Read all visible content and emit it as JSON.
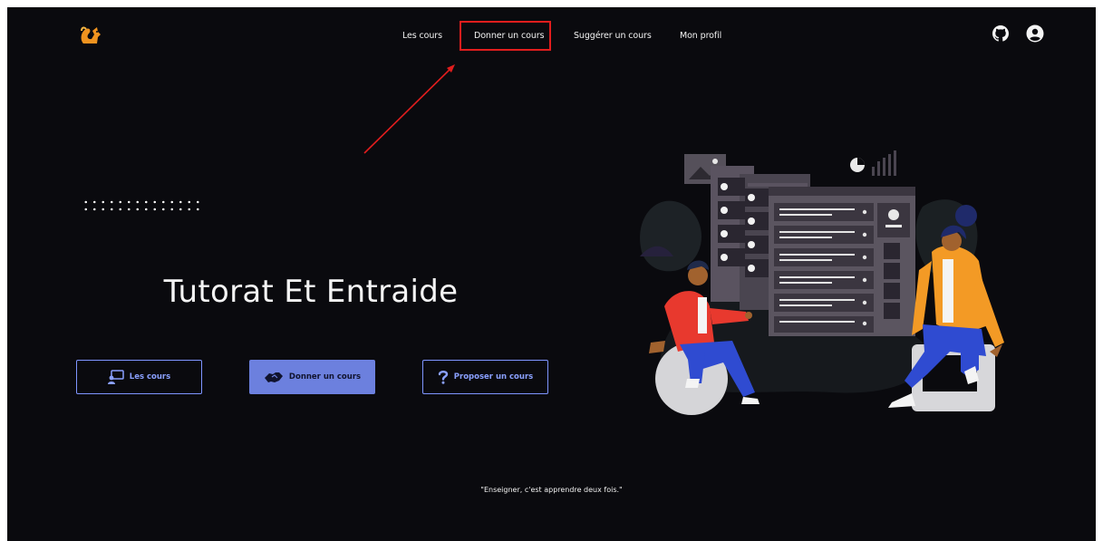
{
  "brand": {
    "logo_icon": "squirrel-logo-icon",
    "accent": "#f0931f"
  },
  "nav": {
    "items": [
      "Les cours",
      "Donner un cours",
      "Suggérer un cours",
      "Mon profil"
    ],
    "highlight_color": "#e11d1d"
  },
  "header_icons": [
    "github-icon",
    "user-circle-icon"
  ],
  "hero": {
    "title": "Tutorat Et Entraide",
    "buttons": [
      {
        "label": "Les cours",
        "icon": "teacher-board-icon"
      },
      {
        "label": "Donner un cours",
        "icon": "handshake-icon"
      },
      {
        "label": "Proposer un cours",
        "icon": "question-mark-icon"
      }
    ],
    "quote": "\"Enseigner, c'est apprendre deux fois.\""
  },
  "colors": {
    "background": "#0a0a0e",
    "button_accent": "#6c80de"
  }
}
